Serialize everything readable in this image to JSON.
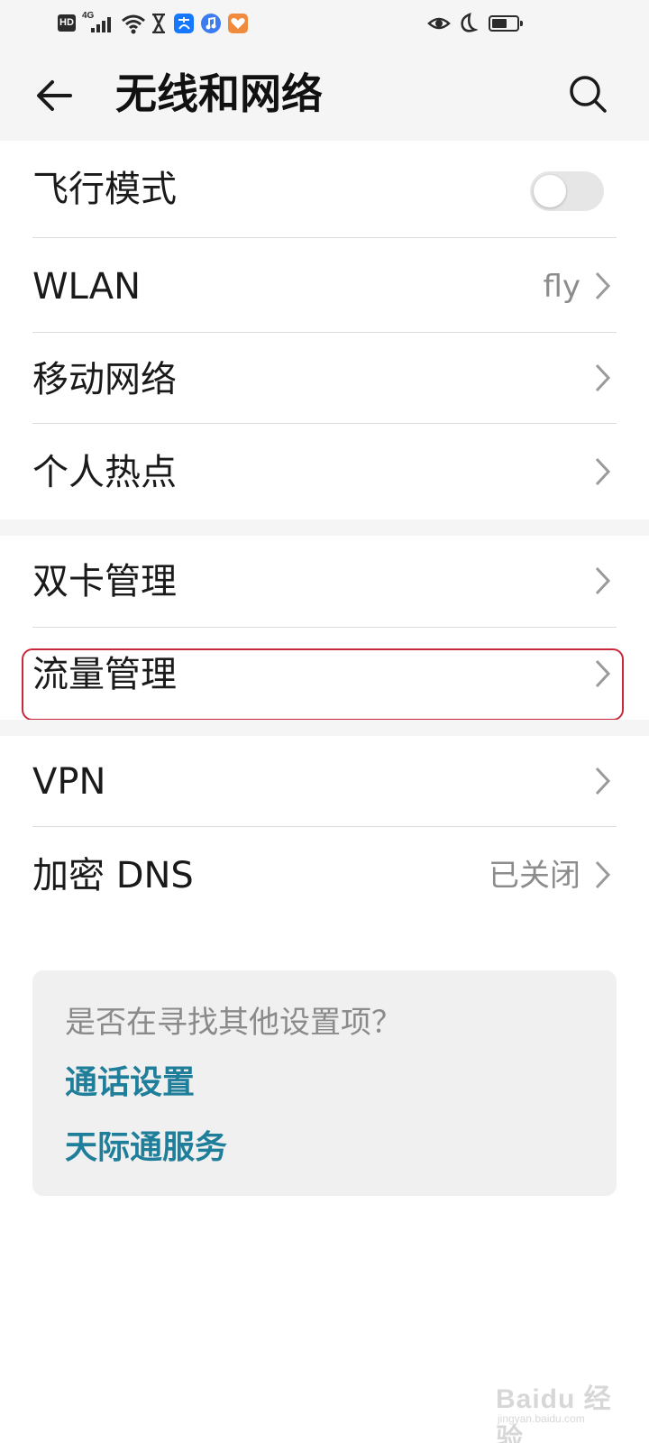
{
  "status_bar": {
    "hd_label": "HD",
    "network_label": "4G",
    "icons": [
      "hd-icon",
      "signal-icon",
      "wifi-icon",
      "hourglass-icon",
      "alipay-icon",
      "music-icon",
      "health-icon",
      "eye-comfort-icon",
      "moon-icon",
      "battery-icon"
    ],
    "battery_level_percent": 60,
    "app_colors": {
      "alipay": "#1677ff",
      "music": "#3d7bf0",
      "health": "#f08a3c"
    }
  },
  "header": {
    "title": "无线和网络",
    "back_icon": "arrow-left-icon",
    "search_icon": "search-icon"
  },
  "groups": [
    {
      "items": [
        {
          "label": "飞行模式",
          "control": "toggle",
          "toggle_on": false
        },
        {
          "label": "WLAN",
          "value": "fly",
          "control": "chevron"
        },
        {
          "label": "移动网络",
          "control": "chevron"
        },
        {
          "label": "个人热点",
          "control": "chevron"
        }
      ]
    },
    {
      "items": [
        {
          "label": "双卡管理",
          "control": "chevron"
        },
        {
          "label": "流量管理",
          "control": "chevron",
          "highlighted": true
        }
      ]
    },
    {
      "items": [
        {
          "label": "VPN",
          "control": "chevron"
        },
        {
          "label": "加密 DNS",
          "value": "已关闭",
          "control": "chevron"
        }
      ]
    }
  ],
  "suggestions": {
    "title": "是否在寻找其他设置项？",
    "links": [
      "通话设置",
      "天际通服务"
    ]
  },
  "watermark": {
    "main": "Baidu 经验",
    "sub": "jingyan.baidu.com"
  },
  "colors": {
    "background_gray": "#f5f5f5",
    "link": "#1f7f9a",
    "highlight": "#c8283a",
    "secondary_text": "#8c8c8c"
  }
}
